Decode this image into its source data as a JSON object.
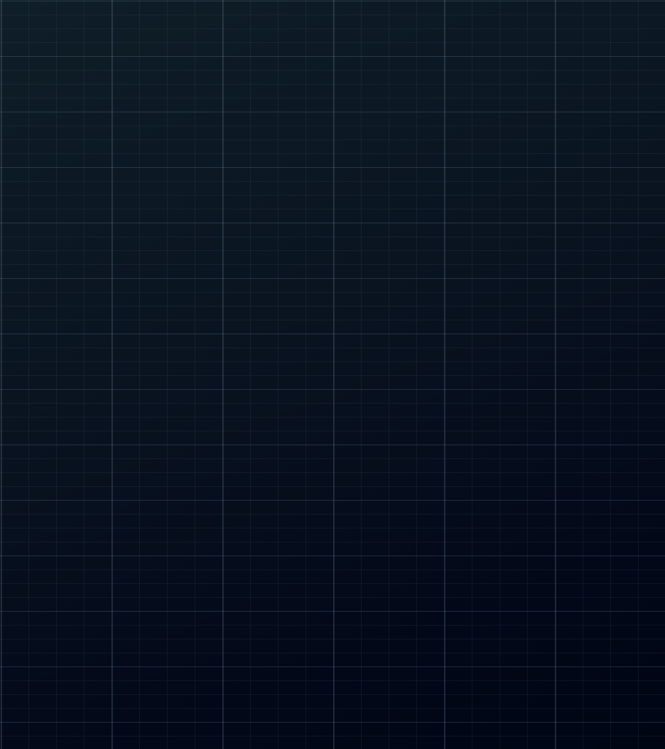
{
  "background": {
    "gradient_top_color": "#0f1e28",
    "gradient_bottom_color": "#000514",
    "grid_line_color": "#6e8ca0"
  }
}
